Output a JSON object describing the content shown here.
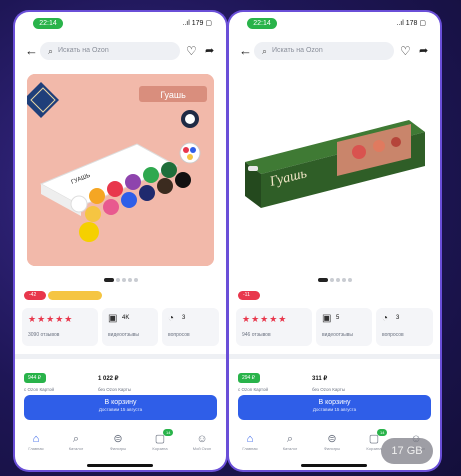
{
  "colors": {
    "accent_blue": "#2f5ee8",
    "green_badge": "#29b34a",
    "star_red": "#e8374c",
    "promo_yellow": "#f5c542",
    "background": "#1e1656"
  },
  "phones": [
    {
      "status_time": "22:14",
      "status_icons": "..ıl 179 ▢",
      "search_placeholder": "Искать на Ozon",
      "image_label": "Гуашь",
      "badges": [
        "-42",
        ""
      ],
      "rating_stars": "★★★★★",
      "rating_text": "3090 отзывов",
      "reviews_count": "4K",
      "reviews_label": "видеоотзывы",
      "questions_count": "3",
      "questions_label": "вопросов",
      "price_badge": "944 ₽",
      "price_sub": "с Ozon Картой",
      "price_main": "1 022 ₽",
      "price_desc": "без Ozon Карты",
      "cart_label": "В корзину",
      "cart_sub": "Доставим 15 августа",
      "tabs": [
        "Главная",
        "Каталог",
        "Фильтры",
        "Корзина",
        "Мой Ozon"
      ],
      "cart_tab_badge": "14"
    },
    {
      "status_time": "22:14",
      "status_icons": "..ıl 178 ▢",
      "search_placeholder": "Искать на Ozon",
      "image_label": "Гуашь",
      "badges": [
        "-11"
      ],
      "rating_stars": "★★★★★",
      "rating_text": "946 отзывов",
      "reviews_count": "5",
      "reviews_label": "видеоотзывы",
      "questions_count": "3",
      "questions_label": "вопросов",
      "price_badge": "294 ₽",
      "price_sub": "с Ozon Картой",
      "price_main": "311 ₽",
      "price_desc": "без Ozon Карты",
      "cart_label": "В корзину",
      "cart_sub": "Доставим 15 августа",
      "tabs": [
        "Главная",
        "Каталог",
        "Фильтры",
        "Корзина",
        "Мой Ozon"
      ],
      "cart_tab_badge": "14"
    }
  ],
  "overlay": {
    "storage_label": "17 GB"
  }
}
